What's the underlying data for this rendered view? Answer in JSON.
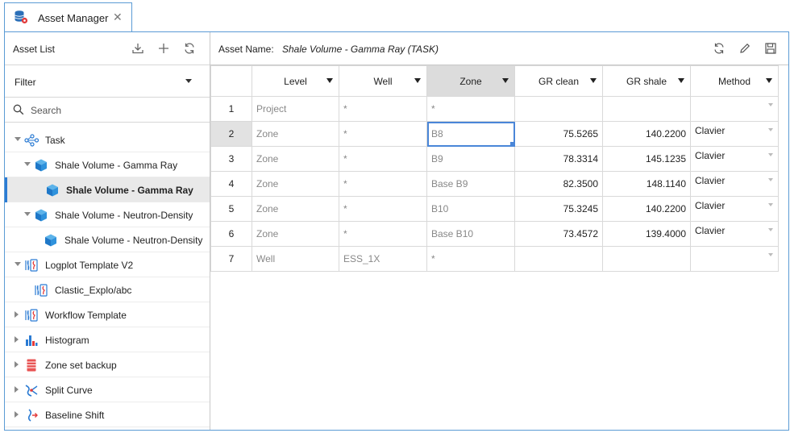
{
  "tab": {
    "title": "Asset Manager",
    "close_glyph": "✕",
    "icon": "database-settings-icon"
  },
  "left_panel": {
    "title": "Asset List",
    "buttons": [
      {
        "name": "import-icon"
      },
      {
        "name": "add-icon"
      },
      {
        "name": "refresh-icon"
      }
    ],
    "filter": {
      "label": "Filter"
    },
    "search": {
      "placeholder": "Search"
    },
    "tree": [
      {
        "label": "Task",
        "level": 0,
        "caret": "down",
        "icon": "workflow-icon"
      },
      {
        "label": "Shale Volume - Gamma Ray",
        "level": 1,
        "caret": "down",
        "icon": "cube-icon"
      },
      {
        "label": "Shale Volume - Gamma Ray",
        "level": 2,
        "caret": "none",
        "icon": "cube-icon",
        "selected": true
      },
      {
        "label": "Shale Volume - Neutron-Density",
        "level": 1,
        "caret": "down",
        "icon": "cube-icon"
      },
      {
        "label": "Shale Volume - Neutron-Density",
        "level": 2,
        "caret": "none",
        "icon": "cube-icon"
      },
      {
        "label": "Logplot Template V2",
        "level": 0,
        "caret": "down",
        "icon": "logplot-icon"
      },
      {
        "label": "Clastic_Explo/abc",
        "level": 1,
        "caret": "none",
        "icon": "logplot-icon"
      },
      {
        "label": "Workflow Template",
        "level": 0,
        "caret": "right",
        "icon": "logplot-icon"
      },
      {
        "label": "Histogram",
        "level": 0,
        "caret": "right",
        "icon": "histogram-icon"
      },
      {
        "label": "Zone set backup",
        "level": 0,
        "caret": "right",
        "icon": "zone-set-icon"
      },
      {
        "label": "Split Curve",
        "level": 0,
        "caret": "right",
        "icon": "split-curve-icon"
      },
      {
        "label": "Baseline Shift",
        "level": 0,
        "caret": "right",
        "icon": "baseline-shift-icon"
      }
    ]
  },
  "right_panel": {
    "asset_name_label": "Asset Name:",
    "asset_name_value": "Shale Volume - Gamma Ray (TASK)",
    "buttons": [
      {
        "name": "refresh-icon"
      },
      {
        "name": "edit-icon"
      },
      {
        "name": "save-icon"
      }
    ],
    "table": {
      "columns": [
        "",
        "Level",
        "Well",
        "Zone",
        "GR clean",
        "GR shale",
        "Method"
      ],
      "sorted_column": "Zone",
      "rows": [
        {
          "num": "1",
          "level": "Project",
          "well": "*",
          "zone": "*",
          "gr_clean": "",
          "gr_shale": "",
          "method": ""
        },
        {
          "num": "2",
          "level": "Zone",
          "well": "*",
          "zone": "B8",
          "gr_clean": "75.5265",
          "gr_shale": "140.2200",
          "method": "Clavier"
        },
        {
          "num": "3",
          "level": "Zone",
          "well": "*",
          "zone": "B9",
          "gr_clean": "78.3314",
          "gr_shale": "145.1235",
          "method": "Clavier"
        },
        {
          "num": "4",
          "level": "Zone",
          "well": "*",
          "zone": "Base B9",
          "gr_clean": "82.3500",
          "gr_shale": "148.1140",
          "method": "Clavier"
        },
        {
          "num": "5",
          "level": "Zone",
          "well": "*",
          "zone": "B10",
          "gr_clean": "75.3245",
          "gr_shale": "140.2200",
          "method": "Clavier"
        },
        {
          "num": "6",
          "level": "Zone",
          "well": "*",
          "zone": "Base B10",
          "gr_clean": "73.4572",
          "gr_shale": "139.4000",
          "method": "Clavier"
        },
        {
          "num": "7",
          "level": "Well",
          "well": "ESS_1X",
          "zone": "*",
          "gr_clean": "",
          "gr_shale": "",
          "method": ""
        }
      ],
      "active_row": "2",
      "selected_cell": {
        "row": "2",
        "column": "zone"
      }
    }
  },
  "colors": {
    "accent": "#2b7bd3",
    "border": "#5b9bd5",
    "selection": "#4a86d8"
  }
}
